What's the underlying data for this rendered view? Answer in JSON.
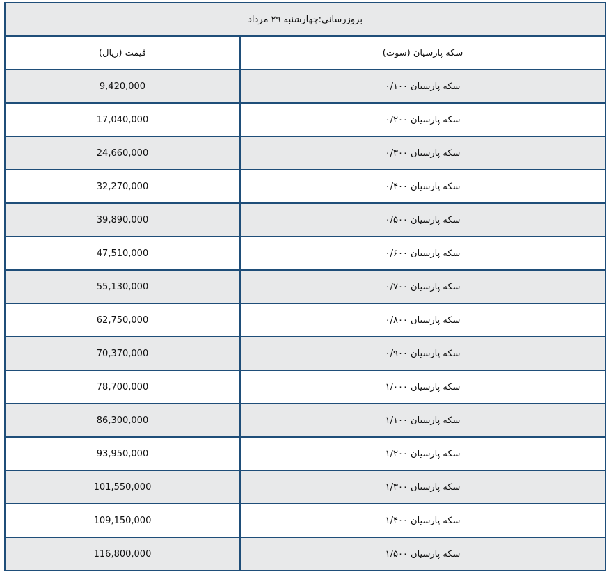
{
  "table": {
    "title": "بروزرسانی:چهارشنبه ۲۹ مرداد",
    "headers": {
      "name": "سکه پارسیان (سوت)",
      "price": "قیمت (ریال)"
    },
    "rows": [
      {
        "name": "سکه پارسیان ۰/۱۰۰",
        "price": "9,420,000"
      },
      {
        "name": "سکه پارسیان ۰/۲۰۰",
        "price": "17,040,000"
      },
      {
        "name": "سکه پارسیان ۰/۳۰۰",
        "price": "24,660,000"
      },
      {
        "name": "سکه پارسیان ۰/۴۰۰",
        "price": "32,270,000"
      },
      {
        "name": "سکه پارسیان ۰/۵۰۰",
        "price": "39,890,000"
      },
      {
        "name": "سکه پارسیان ۰/۶۰۰",
        "price": "47,510,000"
      },
      {
        "name": "سکه پارسیان ۰/۷۰۰",
        "price": "55,130,000"
      },
      {
        "name": "سکه پارسیان ۰/۸۰۰",
        "price": "62,750,000"
      },
      {
        "name": "سکه پارسیان ۰/۹۰۰",
        "price": "70,370,000"
      },
      {
        "name": "سکه پارسیان ۱/۰۰۰",
        "price": "78,700,000"
      },
      {
        "name": "سکه پارسیان ۱/۱۰۰",
        "price": "86,300,000"
      },
      {
        "name": "سکه پارسیان ۱/۲۰۰",
        "price": "93,950,000"
      },
      {
        "name": "سکه پارسیان ۱/۳۰۰",
        "price": "101,550,000"
      },
      {
        "name": "سکه پارسیان ۱/۴۰۰",
        "price": "109,150,000"
      },
      {
        "name": "سکه پارسیان ۱/۵۰۰",
        "price": "116,800,000"
      }
    ]
  },
  "colors": {
    "border": "#1f4e79",
    "shaded_row": "#e8e9ea",
    "plain_row": "#ffffff"
  }
}
